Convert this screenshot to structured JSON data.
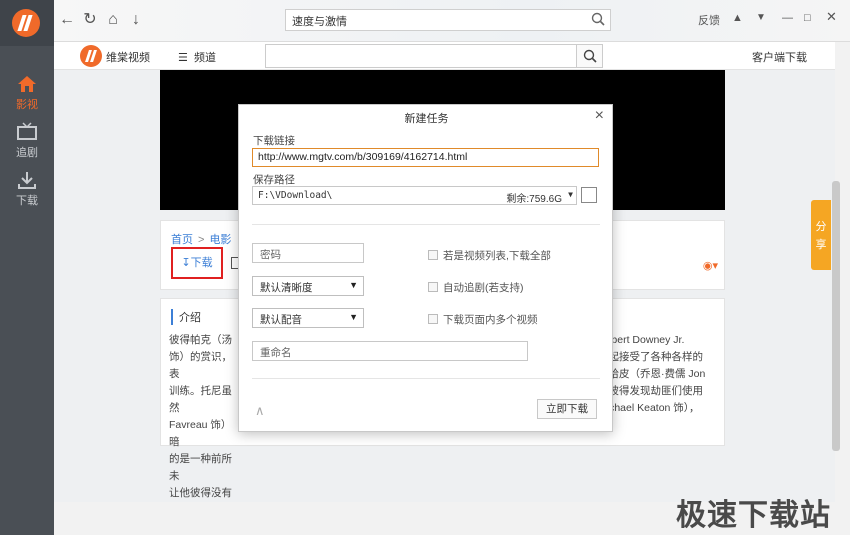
{
  "sidebar": {
    "items": [
      {
        "label": "影视",
        "icon": "home-icon",
        "active": true
      },
      {
        "label": "追剧",
        "icon": "tv-icon",
        "active": false
      },
      {
        "label": "下载",
        "icon": "download-icon",
        "active": false
      }
    ]
  },
  "toolbar": {
    "address": "速度与激情",
    "feedback": "反馈"
  },
  "site": {
    "name": "维棠视频",
    "channel": "频道",
    "client_download": "客户端下载"
  },
  "breadcrumb": {
    "home": "首页",
    "sep": ">",
    "category": "电影"
  },
  "download_label": "下载",
  "intro": {
    "title": "介绍",
    "left_lines": [
      "彼得帕克（汤",
      "饰）的赏识，表",
      "训练。托尼虽然",
      "Favreau 饰）暗",
      "的是一种前所未",
      "让他彼得没有想"
    ],
    "right_lines": [
      "Robert Downey Jr.",
      "一起接受了各种各样的",
      "工哈皮（乔恩·费儒 Jon",
      "，彼得发现劫匪们使用",
      "Michael Keaton 饰），",
      ""
    ]
  },
  "share_tab": "分享",
  "watermark": "极速下载站",
  "dialog": {
    "title": "新建任务",
    "url_label": "下载链接",
    "url_value": "http://www.mgtv.com/b/309169/4162714.html",
    "path_label": "保存路径",
    "path_value": "F:\\VDownload\\",
    "free_space": "剩余:759.6G",
    "password_placeholder": "密码",
    "quality": "默认清晰度",
    "audio": "默认配音",
    "rename_placeholder": "重命名",
    "opt_all": "若是视频列表,下载全部",
    "opt_follow": "自动追剧(若支持)",
    "opt_multi": "下载页面内多个视频",
    "start": "立即下载"
  },
  "colors": {
    "accent": "#f06a2a",
    "link": "#3c7fd6",
    "sidebar": "#4a4f55"
  }
}
